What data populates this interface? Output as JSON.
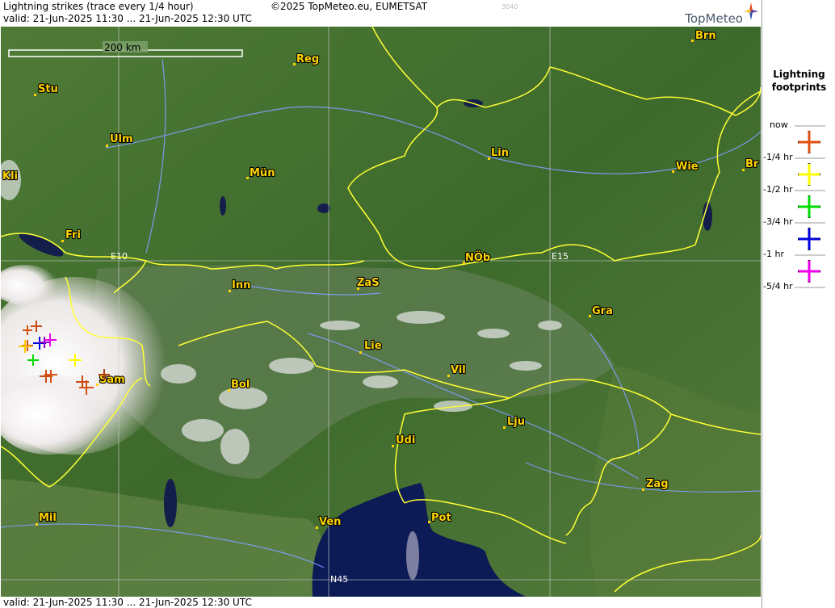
{
  "header": {
    "title": "Lightning strikes (trace every 1/4 hour)",
    "copyright": "©2025 TopMeteo.eu, EUMETSAT",
    "small_code": "3040",
    "valid": "valid:  21-Jun-2025 11:30 ... 21-Jun-2025 12:30 UTC",
    "logo": "TopMeteo"
  },
  "footer": {
    "valid": "valid:  21-Jun-2025 11:30 ... 21-Jun-2025 12:30 UTC"
  },
  "scale_bar": {
    "label": "200 km"
  },
  "grid_labels": {
    "e10": "E10",
    "e15": "E15",
    "n45": "N45"
  },
  "cities": [
    "Brn",
    "Reg",
    "Stu",
    "Ulm",
    "Lin",
    "Wie",
    "Br",
    "Kli",
    "Mün",
    "Fri",
    "NÖb",
    "Inn",
    "ZaS",
    "Gra",
    "Lie",
    "Sam",
    "Vil",
    "Bol",
    "Lju",
    "Udi",
    "Zag",
    "Mil",
    "Ven",
    "Pot"
  ],
  "legend": {
    "title_line1": "Lightning",
    "title_line2": "footprints",
    "items": [
      {
        "label": "now",
        "color": "#e05010"
      },
      {
        "label": "-1/4 hr",
        "color": "#ffff00"
      },
      {
        "label": "-1/2 hr",
        "color": "#00dd00"
      },
      {
        "label": "-3/4 hr",
        "color": "#0000dd"
      },
      {
        "label": "-1 hr",
        "color": "#ee00ee"
      },
      {
        "label": "-5/4 hr",
        "color": ""
      }
    ]
  },
  "colors": {
    "border": "#ffff33",
    "river": "#7f9fff",
    "sea": "#0c1a55"
  }
}
